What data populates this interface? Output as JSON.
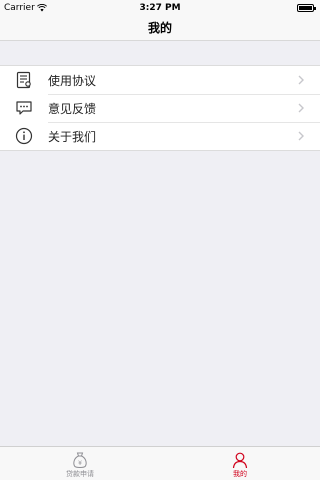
{
  "status_bar": {
    "carrier": "Carrier",
    "time": "3:27 PM"
  },
  "nav": {
    "title": "我的"
  },
  "menu": {
    "items": [
      {
        "label": "使用协议",
        "icon": "agreement-icon"
      },
      {
        "label": "意见反馈",
        "icon": "feedback-icon"
      },
      {
        "label": "关于我们",
        "icon": "info-icon"
      }
    ]
  },
  "tab_bar": {
    "tabs": [
      {
        "label": "贷款申请",
        "icon": "money-bag-icon",
        "active": false
      },
      {
        "label": "我的",
        "icon": "person-icon",
        "active": true
      }
    ],
    "active_color": "#d0011b",
    "inactive_color": "#8e8e93"
  }
}
